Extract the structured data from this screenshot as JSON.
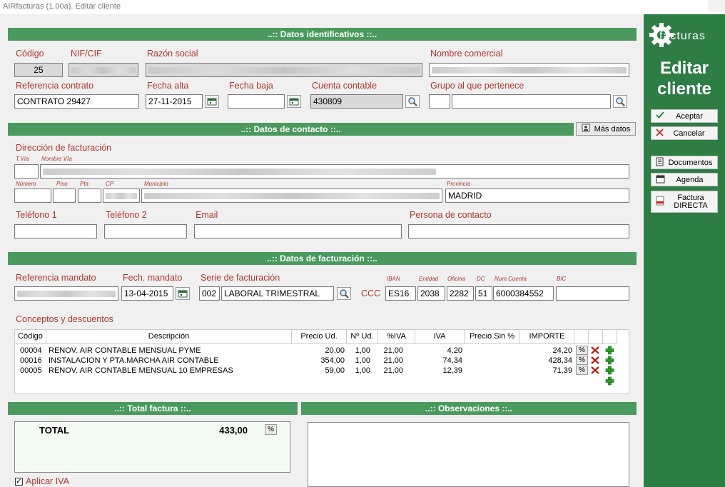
{
  "window": {
    "title": "AIRfacturas (1.00a). Editar cliente"
  },
  "sections": {
    "identificativos": "..:: Datos identificativos ::..",
    "contacto": "..:: Datos de contacto ::..",
    "facturacion": "..:: Datos de facturación ::..",
    "total": "..:: Total factura ::..",
    "observaciones": "..:: Observaciones ::.."
  },
  "ident": {
    "codigo_label": "Código",
    "codigo_value": "25",
    "nif_label": "NIF/CIF",
    "razon_label": "Razón social",
    "nombre_label": "Nombre comercial",
    "ref_label": "Referencia contrato",
    "ref_value": "CONTRATO 29427",
    "alta_label": "Fecha alta",
    "alta_value": "27-11-2015",
    "baja_label": "Fecha baja",
    "baja_value": "",
    "cuenta_label": "Cuenta contable",
    "cuenta_value": "430809",
    "grupo_label": "Grupo al que pertenece"
  },
  "contacto": {
    "mas_datos": "Más datos",
    "direccion_label": "Dirección de facturación",
    "tvia_label": "T.Vía",
    "nombre_via_label": "Nombre Vía",
    "numero_label": "Número",
    "piso_label": "Piso",
    "pta_label": "Pta",
    "cp_label": "CP",
    "municipio_label": "Municipio",
    "provincia_label": "Provincia",
    "provincia_value": "MADRID",
    "tel1_label": "Teléfono 1",
    "tel2_label": "Teléfono 2",
    "email_label": "Email",
    "persona_label": "Persona de contacto"
  },
  "facturacion": {
    "mandato_label": "Referencia mandato",
    "fmandato_label": "Fech. mandato",
    "fmandato_value": "13-04-2015",
    "serie_label": "Serie de facturación",
    "serie_code": "002",
    "serie_name": "LABORAL TRIMESTRAL",
    "ccc_label": "CCC",
    "iban_label": "IBAN",
    "entidad_label": "Entidad",
    "oficina_label": "Oficina",
    "dc_label": "DC",
    "numcuenta_label": "Num.Cuenta",
    "bic_label": "BIC",
    "iban_value": "ES16",
    "entidad_value": "2038",
    "oficina_value": "2282",
    "dc_value": "51",
    "numcuenta_value": "6000384552",
    "bic_value": "",
    "conceptos_label": "Conceptos y descuentos"
  },
  "conceptos": {
    "columns": [
      "Código",
      "Descripción",
      "Precio Ud.",
      "Nº Ud.",
      "%IVA",
      "IVA",
      "Precio Sin %",
      "IMPORTE"
    ],
    "rows": [
      {
        "codigo": "00004",
        "desc": "RENOV. AIR CONTABLE MENSUAL PYME",
        "precio": "20,00",
        "uds": "1,00",
        "piva": "21,00",
        "iva": "4,20",
        "sin": "",
        "importe": "24,20"
      },
      {
        "codigo": "00016",
        "desc": "INSTALACION Y PTA.MARCHA AIR CONTABLE",
        "precio": "354,00",
        "uds": "1,00",
        "piva": "21,00",
        "iva": "74,34",
        "sin": "",
        "importe": "428,34"
      },
      {
        "codigo": "00005",
        "desc": "RENOV. AIR CONTABLE MENSUAL 10 EMPRESAS",
        "precio": "59,00",
        "uds": "1,00",
        "piva": "21,00",
        "iva": "12,39",
        "sin": "",
        "importe": "71,39"
      }
    ],
    "pct_label": "%"
  },
  "total": {
    "label": "TOTAL",
    "value": "433,00",
    "pct_label": "%"
  },
  "aplicar_iva": {
    "label": "Aplicar IVA",
    "checked": true
  },
  "sidebar": {
    "logo_text": "facturas",
    "title_line1": "Editar",
    "title_line2": "cliente",
    "aceptar": "Aceptar",
    "cancelar": "Cancelar",
    "documentos": "Documentos",
    "agenda": "Agenda",
    "factura_line1": "Factura",
    "factura_line2": "DIRECTA"
  },
  "colors": {
    "section_header": "#4a9a5f",
    "sidebar": "#2e7d45",
    "label": "#b3372b"
  }
}
